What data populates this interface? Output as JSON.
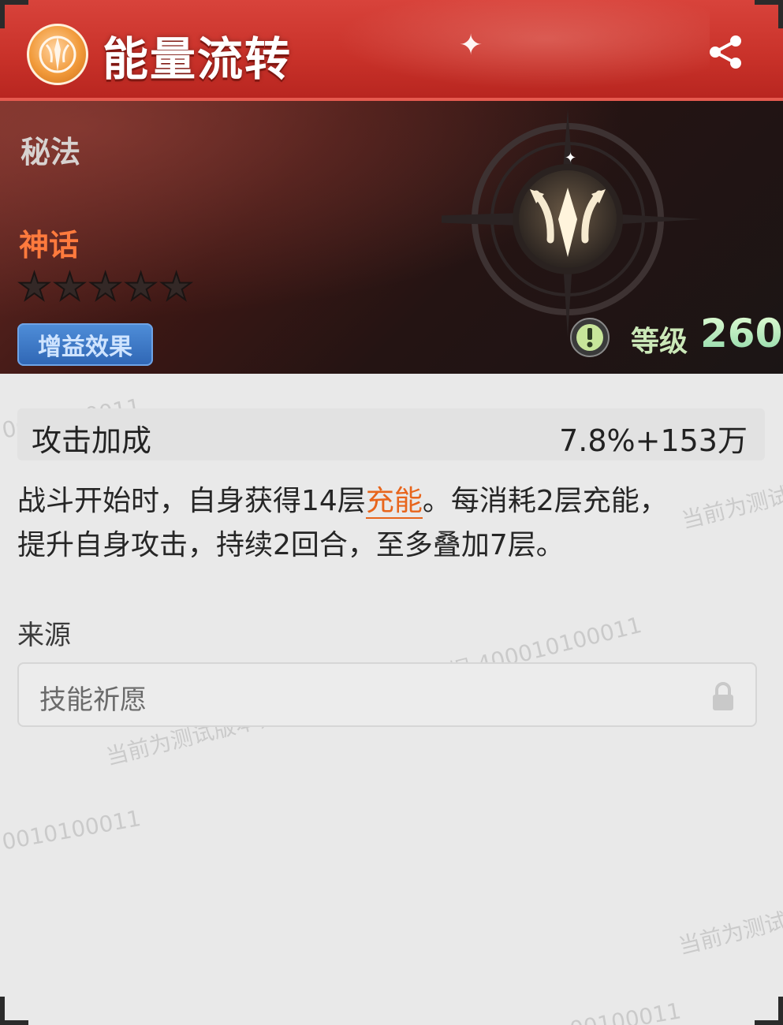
{
  "header": {
    "title": "能量流转",
    "emblem_icon": "sun-crest-icon",
    "share_icon": "share-icon"
  },
  "hero": {
    "category": "秘法",
    "rarity": "神话",
    "rarity_color": "#ff7a3d",
    "stars_total": 5,
    "stars_filled": 0,
    "buff_tag": "增益效果",
    "emblem_icon": "trident-emblem-icon",
    "level_alert_icon": "exclamation-icon",
    "level_label": "等级",
    "level_value": "260"
  },
  "stat": {
    "name": "攻击加成",
    "value": "7.8%+153万"
  },
  "description": {
    "part1": "战斗开始时，自身获得14层",
    "highlight": "充能",
    "part2": "。每消耗2层充能，",
    "line2": "提升自身攻击，持续2回合，至多叠加7层。"
  },
  "source": {
    "label": "来源",
    "value": "技能祈愿",
    "lock_icon": "lock-icon"
  },
  "watermarks": {
    "main": "当前为测试版本，不代表最终公测数据 400010100011",
    "code_a": "0010100011",
    "code_b": "0010100011",
    "short_a": "当前为测试",
    "short_b": "当前为测试",
    "code_c": "00100011"
  },
  "colors": {
    "header_red": "#c83129",
    "highlight_orange": "#e8651c",
    "buff_blue": "#2f66b4",
    "level_green": "#bfe3a6"
  }
}
